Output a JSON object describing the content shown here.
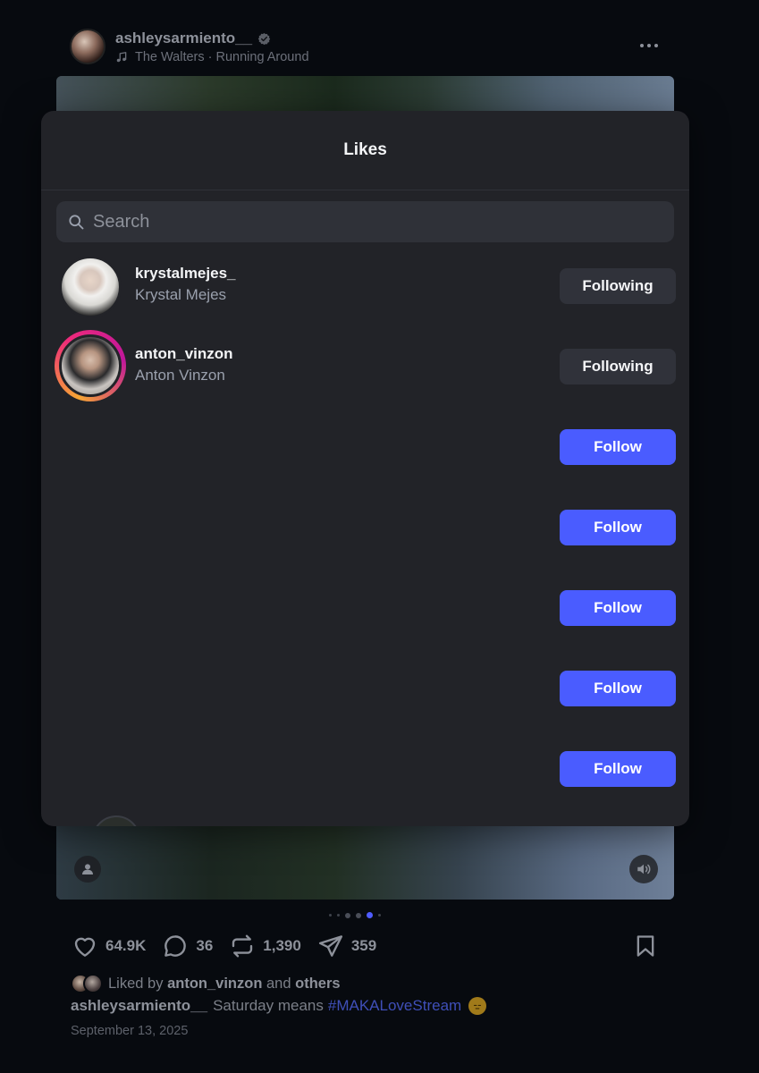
{
  "post": {
    "author": "ashleysarmiento__",
    "song": "The Walters · Running Around",
    "stats": {
      "likes": "64.9K",
      "comments": "36",
      "reposts": "1,390",
      "shares": "359"
    },
    "liked_by": {
      "prefix": "Liked by",
      "user": "anton_vinzon",
      "conjunction": "and",
      "others": "others"
    },
    "caption": {
      "author": "ashleysarmiento__",
      "text": "Saturday means",
      "hashtag": "#MAKALoveStream"
    },
    "date": "September 13, 2025"
  },
  "likes_modal": {
    "title": "Likes",
    "search": {
      "placeholder": "Search",
      "value": ""
    },
    "users": [
      {
        "username": "krystalmejes_",
        "fullname": "Krystal Mejes",
        "button": "Following"
      },
      {
        "username": "anton_vinzon",
        "fullname": "Anton Vinzon",
        "button": "Following"
      },
      {
        "username": "",
        "fullname": "",
        "button": "Follow"
      },
      {
        "username": "",
        "fullname": "",
        "button": "Follow"
      },
      {
        "username": "",
        "fullname": "",
        "button": "Follow"
      },
      {
        "username": "",
        "fullname": "",
        "button": "Follow"
      },
      {
        "username": "",
        "fullname": "",
        "button": "Follow"
      }
    ]
  },
  "icons": {
    "verified": "verified-badge-icon",
    "music": "music-note-icon",
    "more": "more-horizontal-icon",
    "like": "heart-icon",
    "comment": "comment-icon",
    "repost": "repost-icon",
    "share": "send-icon",
    "bookmark": "bookmark-icon",
    "search": "search-icon",
    "user_tag": "user-tag-icon",
    "mute": "speaker-icon"
  },
  "colors": {
    "accent": "#4a5cff",
    "modal_bg": "#222328",
    "page_bg": "#070a0f",
    "following_button": "#30323a",
    "hashtag": "#3f4fb8"
  }
}
